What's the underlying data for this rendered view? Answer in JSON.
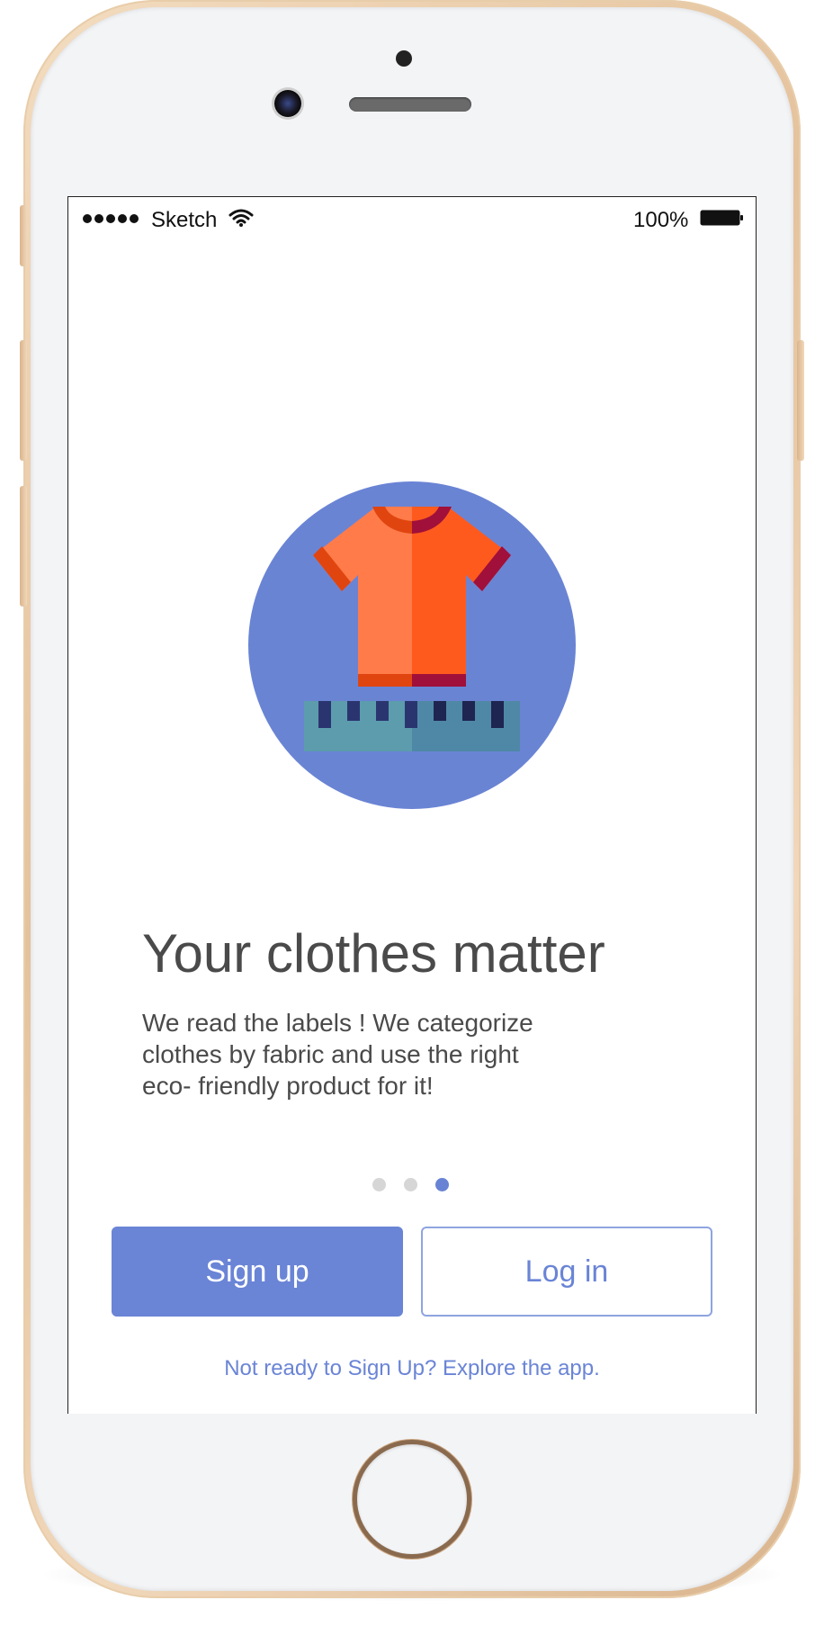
{
  "status_bar": {
    "carrier": "Sketch",
    "battery_percent": "100%"
  },
  "onboarding": {
    "illustration": "t-shirt-with-measuring-ruler-icon",
    "title": "Your clothes matter",
    "description": "We read the labels ! We categorize clothes by fabric and use the right eco- friendly product for it!",
    "page_count": 3,
    "active_page": 3
  },
  "actions": {
    "signup_label": "Sign up",
    "login_label": "Log in",
    "explore_label": "Not ready to Sign Up? Explore the app."
  },
  "colors": {
    "accent": "#6a84d6",
    "illustration_circle": "#6a84d4",
    "shirt_light": "#ff7b4a",
    "shirt_dark": "#ff5a1e",
    "ruler": "#5c9cad",
    "text": "#4a4a4a"
  }
}
